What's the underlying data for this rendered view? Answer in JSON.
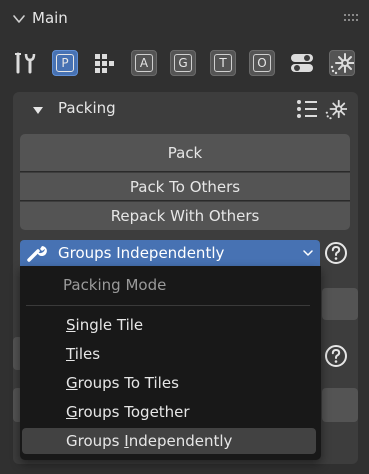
{
  "panel": {
    "title": "Main"
  },
  "toolbar": {
    "buttons": [
      {
        "icon": "wrench-screwdriver-icon"
      },
      {
        "label": "P",
        "active": true
      },
      {
        "icon": "grid-blocks-icon"
      },
      {
        "label": "A"
      },
      {
        "label": "G"
      },
      {
        "label": "T"
      },
      {
        "label": "O"
      },
      {
        "icon": "toggle-settings-icon"
      },
      {
        "icon": "gear-icon"
      }
    ]
  },
  "packing": {
    "title": "Packing",
    "buttons": {
      "pack": "Pack",
      "pack_to_others": "Pack To Others",
      "repack_with_others": "Repack With Others"
    },
    "mode_select": {
      "value": "Groups Independently"
    },
    "mode_menu": {
      "title": "Packing Mode",
      "options": [
        "Single Tile",
        "Tiles",
        "Groups To Tiles",
        "Groups Together",
        "Groups Independently"
      ],
      "selected_index": 4
    }
  },
  "colors": {
    "background": "#303030",
    "panel": "#3d3d3d",
    "button": "#545454",
    "accent": "#4772b3",
    "menu": "#181818"
  }
}
